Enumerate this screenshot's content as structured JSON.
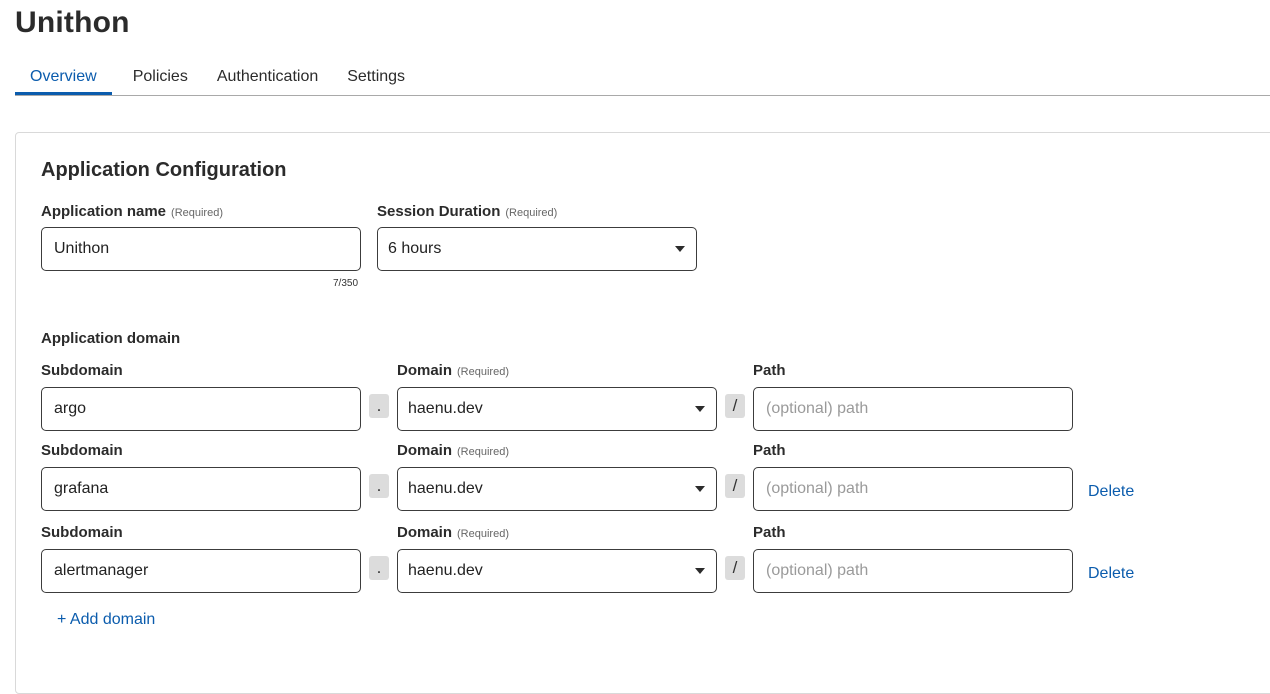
{
  "page": {
    "title": "Unithon"
  },
  "tabs": [
    {
      "label": "Overview"
    },
    {
      "label": "Policies"
    },
    {
      "label": "Authentication"
    },
    {
      "label": "Settings"
    }
  ],
  "config": {
    "title": "Application Configuration",
    "app_name": {
      "label": "Application name",
      "required": "(Required)",
      "value": "Unithon",
      "counter": "7/350"
    },
    "session": {
      "label": "Session Duration",
      "required": "(Required)",
      "value": "6 hours"
    }
  },
  "domains": {
    "title": "Application domain",
    "subdomain_label": "Subdomain",
    "domain_label": "Domain",
    "required": "(Required)",
    "path_label": "Path",
    "path_placeholder": "(optional) path",
    "dot": ".",
    "slash": "/",
    "delete_label": "Delete",
    "rows": [
      {
        "subdomain": "argo",
        "domain": "haenu.dev"
      },
      {
        "subdomain": "grafana",
        "domain": "haenu.dev"
      },
      {
        "subdomain": "alertmanager",
        "domain": "haenu.dev"
      }
    ],
    "add_label": "+ Add domain"
  },
  "colors": {
    "accent": "#0b5cad",
    "border": "#3c3c3c",
    "separator": "#dcdcdc"
  },
  "icons": {
    "dropdown": "caret-down-icon"
  }
}
